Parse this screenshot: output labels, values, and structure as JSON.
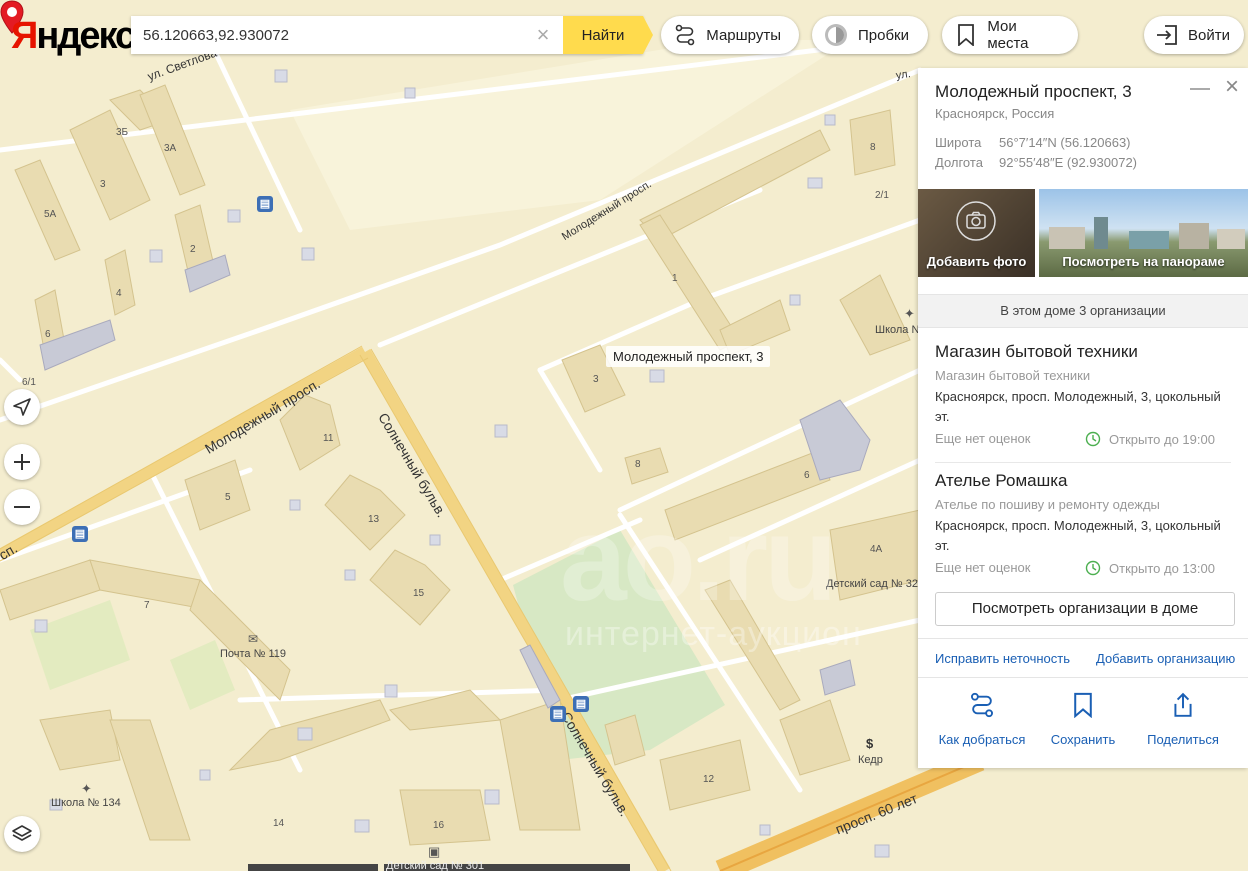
{
  "brand": {
    "logo_first": "Я",
    "logo_rest": "ндекс"
  },
  "search": {
    "value": "56.120663,92.930072",
    "button": "Найти"
  },
  "toolbar": {
    "routes": "Маршруты",
    "traffic": "Пробки",
    "my_places": "Мои места",
    "login": "Войти"
  },
  "map": {
    "marker_label": "Молодежный проспект, 3",
    "streets": {
      "svetlova": "ул. Светлова",
      "molodezhny_upper": "Молодежный просп.",
      "molodezhny_lower": "Молодежный просп.",
      "solnechny_upper": "Солнечный бульв.",
      "solnechny_lower": "Солнечный бульв.",
      "sixty_let": "просп. 60 лет",
      "ul_top": "ул.",
      "sp_left": "сп."
    },
    "house_numbers": [
      "3Б",
      "3А",
      "3",
      "5А",
      "2",
      "4",
      "6",
      "6/1",
      "1",
      "8",
      "2/1",
      "11",
      "5",
      "13",
      "15",
      "7",
      "8",
      "6",
      "4А",
      "12",
      "14",
      "16",
      "3"
    ],
    "pois": {
      "school_n": "Школа N",
      "post": "Почта № 119",
      "school_134": "Школа № 134",
      "kindergarten_32": "Детский сад № 32",
      "kedr": "Кедр",
      "kindergarten_301": "Детский сад № 301"
    },
    "watermark_big": "ao.ru",
    "watermark_small": "интернет-аукцион"
  },
  "panel": {
    "title": "Молодежный проспект, 3",
    "subtitle": "Красноярск, Россия",
    "lat_label": "Широта",
    "lat_value": "56°7′14″N (56.120663)",
    "lon_label": "Долгота",
    "lon_value": "92°55′48″E (92.930072)",
    "add_photo": "Добавить фото",
    "panorama": "Посмотреть на панораме",
    "orgs_header": "В этом доме 3 организации",
    "orgs": [
      {
        "name": "Магазин бытовой техники",
        "category": "Магазин бытовой техники",
        "address": "Красноярск, просп. Молодежный, 3, цокольный эт.",
        "rating": "Еще нет оценок",
        "hours": "Открыто до 19:00"
      },
      {
        "name": "Ателье Ромашка",
        "category": "Ателье по пошиву и ремонту одежды",
        "address": "Красноярск, просп. Молодежный, 3, цокольный эт.",
        "rating": "Еще нет оценок",
        "hours": "Открыто до 13:00"
      }
    ],
    "view_orgs": "Посмотреть организации в доме",
    "fix_error": "Исправить неточность",
    "add_org": "Добавить организацию",
    "actions": {
      "route": "Как добраться",
      "save": "Сохранить",
      "share": "Поделиться"
    }
  },
  "colors": {
    "accent": "#ffdb4d",
    "link": "#1a5fb4",
    "brand_red": "#e61400",
    "open_green": "#4caf50"
  }
}
